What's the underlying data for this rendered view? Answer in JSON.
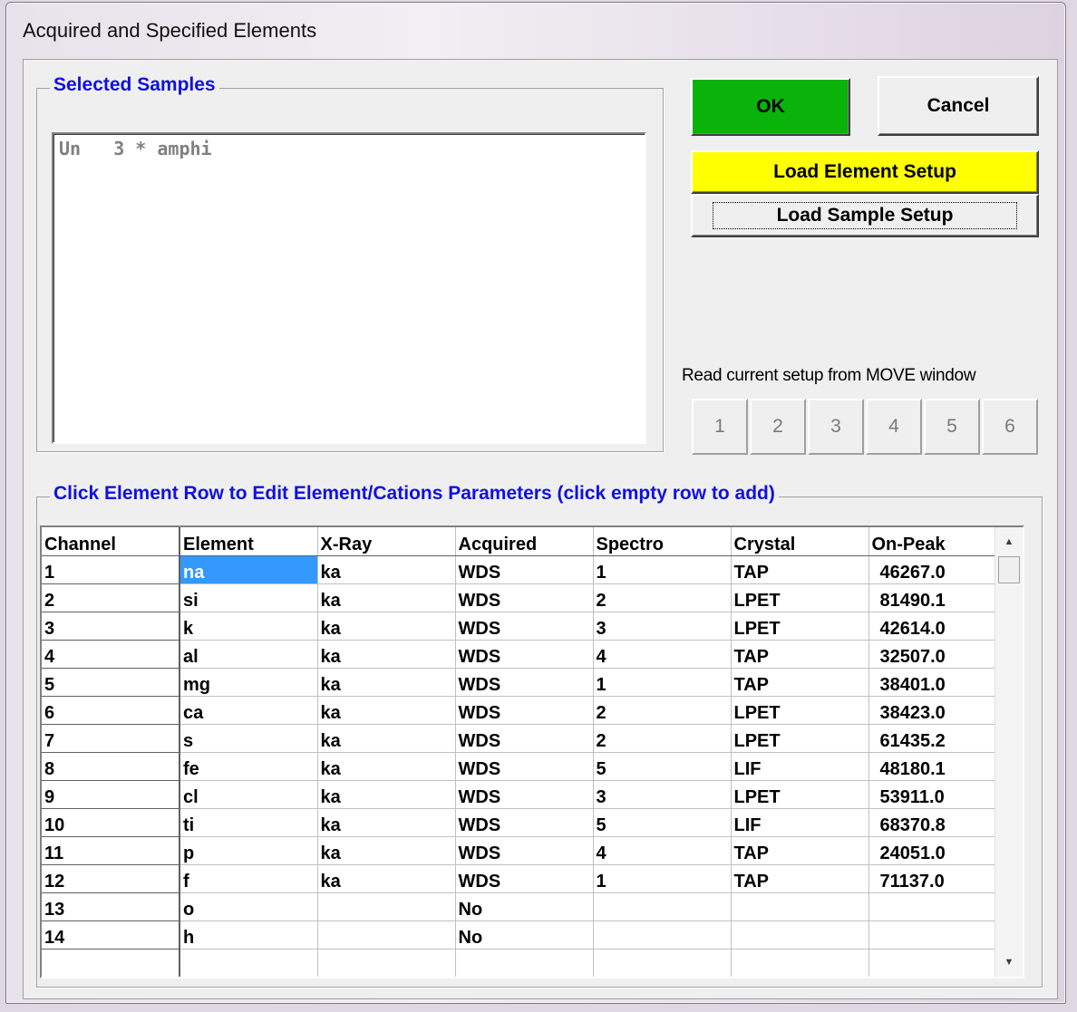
{
  "window": {
    "title": "Acquired and Specified Elements"
  },
  "samples": {
    "group_title": "Selected Samples",
    "items": [
      "Un   3 * amphi"
    ]
  },
  "buttons": {
    "ok": "OK",
    "cancel": "Cancel",
    "load_element_setup": "Load Element Setup",
    "load_sample_setup": "Load Sample Setup"
  },
  "move_window": {
    "label": "Read current setup from MOVE window",
    "buttons": [
      "1",
      "2",
      "3",
      "4",
      "5",
      "6"
    ]
  },
  "elements": {
    "group_title": "Click Element Row to Edit Element/Cations Parameters (click empty row to add)",
    "columns": [
      "Channel",
      "Element",
      "X-Ray",
      "Acquired",
      "Spectro",
      "Crystal",
      "On-Peak"
    ],
    "rows": [
      [
        "1",
        "na",
        "ka",
        "WDS",
        "1",
        "TAP",
        "46267.0"
      ],
      [
        "2",
        "si",
        "ka",
        "WDS",
        "2",
        "LPET",
        "81490.1"
      ],
      [
        "3",
        "k",
        "ka",
        "WDS",
        "3",
        "LPET",
        "42614.0"
      ],
      [
        "4",
        "al",
        "ka",
        "WDS",
        "4",
        "TAP",
        "32507.0"
      ],
      [
        "5",
        "mg",
        "ka",
        "WDS",
        "1",
        "TAP",
        "38401.0"
      ],
      [
        "6",
        "ca",
        "ka",
        "WDS",
        "2",
        "LPET",
        "38423.0"
      ],
      [
        "7",
        "s",
        "ka",
        "WDS",
        "2",
        "LPET",
        "61435.2"
      ],
      [
        "8",
        "fe",
        "ka",
        "WDS",
        "5",
        "LIF",
        "48180.1"
      ],
      [
        "9",
        "cl",
        "ka",
        "WDS",
        "3",
        "LPET",
        "53911.0"
      ],
      [
        "10",
        "ti",
        "ka",
        "WDS",
        "5",
        "LIF",
        "68370.8"
      ],
      [
        "11",
        "p",
        "ka",
        "WDS",
        "4",
        "TAP",
        "24051.0"
      ],
      [
        "12",
        "f",
        "ka",
        "WDS",
        "1",
        "TAP",
        "71137.0"
      ],
      [
        "13",
        "o",
        "",
        "No",
        "",
        "",
        ""
      ],
      [
        "14",
        "h",
        "",
        "No",
        "",
        "",
        ""
      ],
      [
        "",
        "",
        "",
        "",
        "",
        "",
        ""
      ]
    ]
  }
}
